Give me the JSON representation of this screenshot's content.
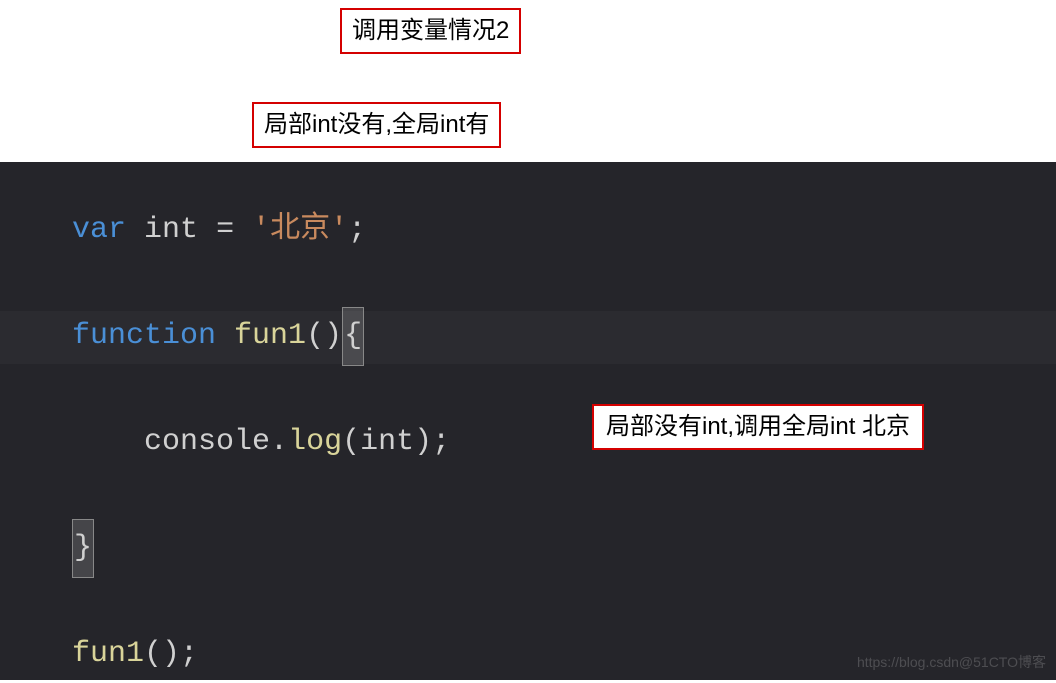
{
  "annotations": {
    "top1_prefix": "调用变量情况",
    "top1_suffix": "2",
    "top2_p1": "局部",
    "top2_p2": "int",
    "top2_p3": "没有,全局",
    "top2_p4": "int",
    "top2_p5": "有",
    "inline_p1": "局部没有",
    "inline_p2": "int",
    "inline_p3": ",调用全局",
    "inline_p4": "int",
    "inline_p5": "  北京"
  },
  "code": {
    "line1": {
      "kw": "var",
      "sp1": " ",
      "name": "int",
      "sp2": " ",
      "eq": "=",
      "sp3": " ",
      "str": "'北京'",
      "end": ";"
    },
    "line2": "",
    "line3": {
      "kw": "function",
      "sp1": " ",
      "fn": "fun1",
      "paren": "()",
      "brace": "{"
    },
    "line4": "",
    "line5": {
      "indent": "    ",
      "obj": "console",
      "dot": ".",
      "method": "log",
      "open": "(",
      "arg": "int",
      "close": ")",
      "end": ";"
    },
    "line6": "",
    "line7": {
      "brace": "}"
    },
    "line8": "",
    "line9": {
      "fn": "fun1",
      "paren": "()",
      "end": ";"
    }
  },
  "watermark": "https://blog.csdn@51CTO博客"
}
